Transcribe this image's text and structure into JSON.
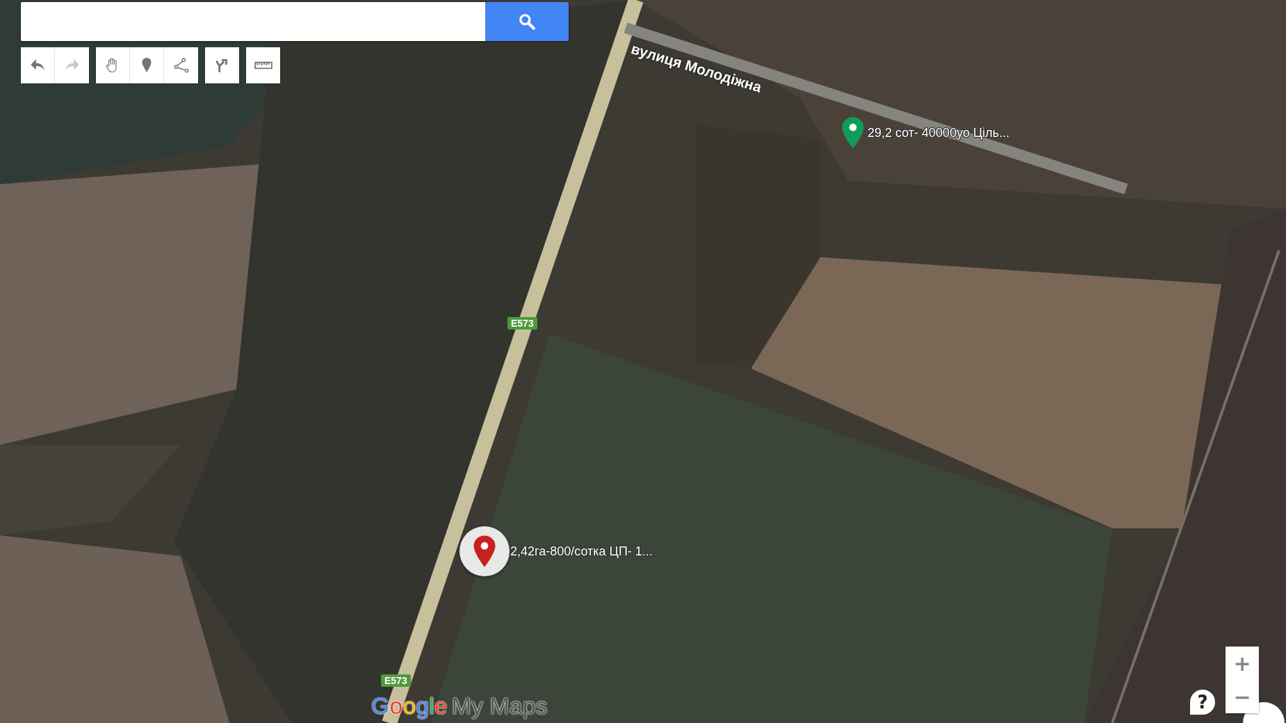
{
  "toolbar": [
    {
      "tools": [
        {
          "kind": "undo",
          "disabled": false
        },
        {
          "kind": "redo",
          "disabled": true
        }
      ]
    },
    {
      "tools": [
        {
          "kind": "hand",
          "disabled": false
        },
        {
          "kind": "marker",
          "disabled": false
        },
        {
          "kind": "line",
          "disabled": false
        }
      ]
    },
    {
      "tools": [
        {
          "kind": "route",
          "disabled": false
        }
      ]
    },
    {
      "tools": [
        {
          "kind": "ruler",
          "disabled": false
        }
      ]
    }
  ],
  "street_labels": [
    "вулиця Молодіжна"
  ],
  "road_labels": [
    "E573",
    "E573"
  ],
  "markers": [
    {
      "label": "29,2 сот- 40000уо Ціль...",
      "color": "#0f9d58",
      "selected": false
    },
    {
      "label": "2,42га-800/сотка ЦП- 1...",
      "color": "#c5221f",
      "selected": true
    }
  ],
  "branding": {
    "google": "Google",
    "product": "My Maps"
  },
  "zoom": {
    "in": "+",
    "out": "−"
  },
  "help": "?"
}
